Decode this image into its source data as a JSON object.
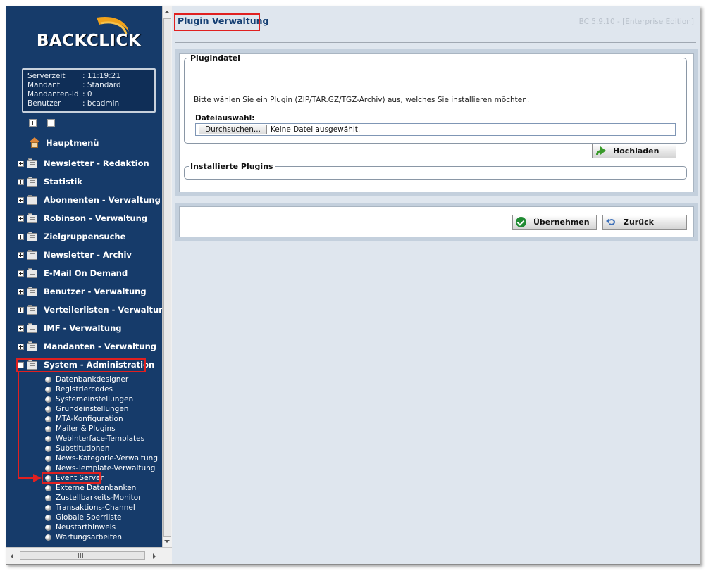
{
  "logo": {
    "text": "BACKCLICK"
  },
  "server_info": [
    {
      "key": "Serverzeit",
      "value": ": 11:19:21"
    },
    {
      "key": "Mandant",
      "value": ": Standard"
    },
    {
      "key": "Mandanten-Id",
      "value": ": 0"
    },
    {
      "key": "Benutzer",
      "value": ": bcadmin"
    }
  ],
  "sidebar": {
    "home_label": "Hauptmenü",
    "menu": [
      {
        "label": "Newsletter - Redaktion",
        "expanded": false
      },
      {
        "label": "Statistik",
        "expanded": false
      },
      {
        "label": "Abonnenten - Verwaltung",
        "expanded": false
      },
      {
        "label": "Robinson - Verwaltung",
        "expanded": false
      },
      {
        "label": "Zielgruppensuche",
        "expanded": false
      },
      {
        "label": "Newsletter - Archiv",
        "expanded": false
      },
      {
        "label": "E-Mail On Demand",
        "expanded": false
      },
      {
        "label": "Benutzer - Verwaltung",
        "expanded": false
      },
      {
        "label": "Verteilerlisten - Verwaltung",
        "expanded": false
      },
      {
        "label": "IMF - Verwaltung",
        "expanded": false
      },
      {
        "label": "Mandanten - Verwaltung",
        "expanded": false
      },
      {
        "label": "System - Administration",
        "expanded": true
      }
    ],
    "sub_items": [
      "Datenbankdesigner",
      "Registriercodes",
      "Systemeinstellungen",
      "Grundeinstellungen",
      "MTA-Konfiguration",
      "Mailer & Plugins",
      "WebInterface-Templates",
      "Substitutionen",
      "News-Kategorie-Verwaltung",
      "News-Template-Verwaltung",
      "Event Server",
      "Externe Datenbanken",
      "Zustellbarkeits-Monitor",
      "Transaktions-Channel",
      "Globale Sperrliste",
      "Neustarthinweis",
      "Wartungsarbeiten"
    ]
  },
  "main": {
    "title": "Plugin Verwaltung",
    "version": "BC 5.9.10 - [Enterprise Edition]",
    "plugin_file": {
      "legend": "Plugindatei",
      "description": "Bitte wählen Sie ein Plugin (ZIP/TAR.GZ/TGZ-Archiv) aus, welches Sie installieren möchten.",
      "file_label": "Dateiauswahl:",
      "browse_label": "Durchsuchen...",
      "no_file_text": "Keine Datei ausgewählt.",
      "upload_label": "Hochladen"
    },
    "installed_legend": "Installierte Plugins",
    "apply_label": "Übernehmen",
    "back_label": "Zurück"
  },
  "colors": {
    "sidebar_bg": "#163b6a",
    "title_color": "#143e72",
    "highlight_red": "#e02020",
    "panel_bg": "#c4d0dd",
    "page_bg": "#dfe6ee"
  }
}
